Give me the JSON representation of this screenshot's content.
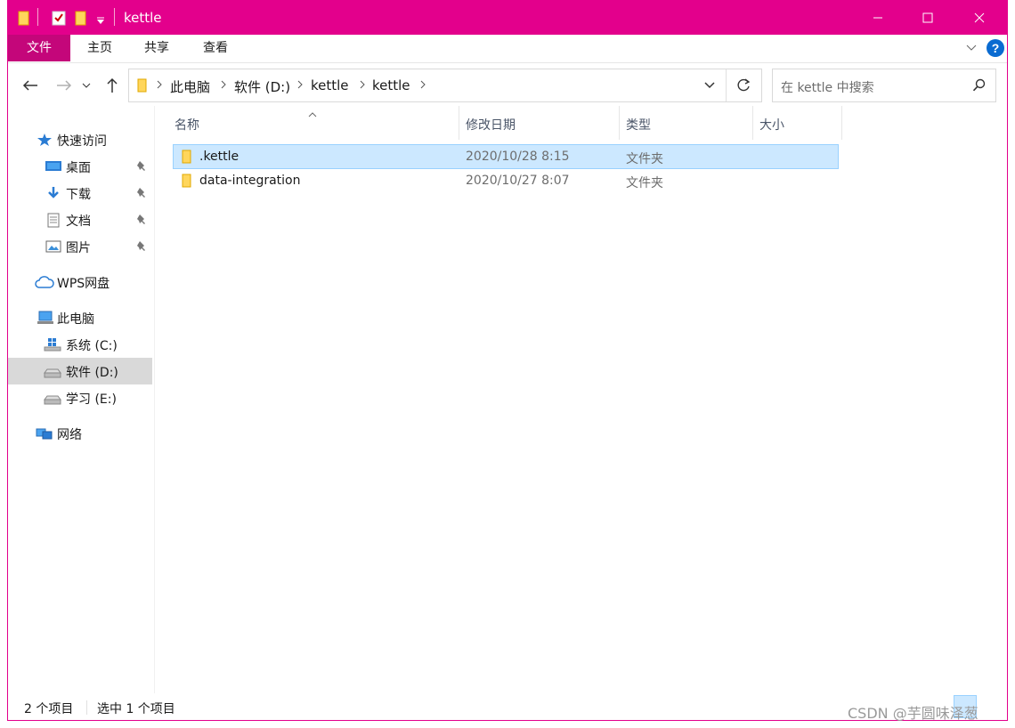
{
  "window": {
    "title": "kettle"
  },
  "ribbon": {
    "tabs": [
      "文件",
      "主页",
      "共享",
      "查看"
    ]
  },
  "address": {
    "segments": [
      "此电脑",
      "软件 (D:)",
      "kettle",
      "kettle"
    ]
  },
  "search": {
    "placeholder": "在 kettle 中搜索"
  },
  "sidebar": {
    "quick_access": "快速访问",
    "pinned": [
      "桌面",
      "下载",
      "文档",
      "图片"
    ],
    "wps": "WPS网盘",
    "this_pc": "此电脑",
    "drives": [
      "系统 (C:)",
      "软件 (D:)",
      "学习 (E:)"
    ],
    "network": "网络",
    "selected": "软件 (D:)"
  },
  "columns": {
    "name": "名称",
    "modified": "修改日期",
    "type": "类型",
    "size": "大小"
  },
  "files": [
    {
      "name": ".kettle",
      "modified": "2020/10/28 8:15",
      "type": "文件夹",
      "size": "",
      "selected": true
    },
    {
      "name": "data-integration",
      "modified": "2020/10/27 8:07",
      "type": "文件夹",
      "size": "",
      "selected": false
    }
  ],
  "status": {
    "count": "2 个项目",
    "selected": "选中 1 个项目"
  },
  "watermark": "CSDN @芋圆味泽葱",
  "colors": {
    "accent": "#e3008c",
    "file_tab": "#c4067a",
    "selection": "#cce8ff"
  },
  "icons": [
    "folder-icon",
    "checkbox-icon",
    "dropdown-icon",
    "minimize-icon",
    "maximize-icon",
    "close-icon",
    "chevron-down-icon",
    "help-icon",
    "back-icon",
    "forward-icon",
    "recent-icon",
    "up-icon",
    "refresh-icon",
    "search-icon",
    "star-icon",
    "desktop-icon",
    "download-icon",
    "document-icon",
    "picture-icon",
    "cloud-icon",
    "computer-icon",
    "drive-icon",
    "network-icon",
    "pin-icon"
  ]
}
